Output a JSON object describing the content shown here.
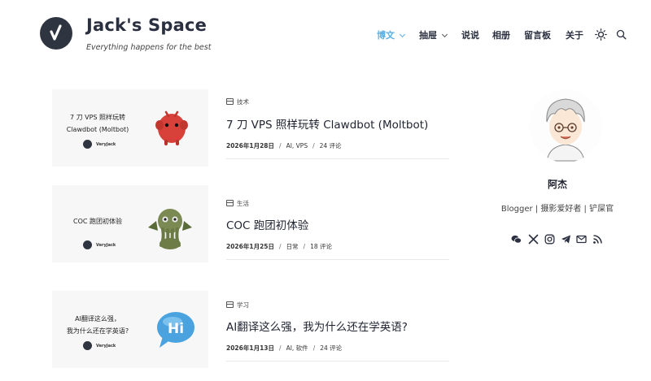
{
  "header": {
    "site_title": "Jack's Space",
    "tagline": "Everything happens for the best",
    "nav": [
      "博文",
      "抽屉",
      "说说",
      "相册",
      "留言板",
      "关于"
    ]
  },
  "posts": [
    {
      "thumb_text_line1": "7 刀 VPS 照样玩转",
      "thumb_text_line2": "Clawdbot (Moltbot)",
      "thumb_brand": "VeryJack",
      "category": "技术",
      "title": "7 刀 VPS 照样玩转 Clawdbot (Moltbot)",
      "date": "2026年1月28日",
      "tags": "AI, VPS",
      "comments": "24 评论"
    },
    {
      "thumb_text_line1": "COC 跑团初体验",
      "thumb_text_line2": "",
      "thumb_brand": "VeryJack",
      "category": "生活",
      "title": "COC 跑团初体验",
      "date": "2026年1月25日",
      "tags": "日常",
      "comments": "18 评论"
    },
    {
      "thumb_text_line1": "AI翻译这么强，",
      "thumb_text_line2": "我为什么还在学英语?",
      "thumb_brand": "VeryJack",
      "thumb_badge": "Hi",
      "category": "学习",
      "title": "AI翻译这么强，我为什么还在学英语?",
      "date": "2026年1月13日",
      "tags": "AI, 软件",
      "comments": "24 评论"
    }
  ],
  "sidebar": {
    "author": "阿杰",
    "bio": "Blogger | 摄影爱好者 | 铲屎官",
    "social_icons": [
      "wechat-icon",
      "x-icon",
      "instagram-icon",
      "telegram-icon",
      "email-icon",
      "rss-icon"
    ]
  },
  "colors": {
    "accent": "#5ab0e6",
    "dark": "#2e3440"
  }
}
